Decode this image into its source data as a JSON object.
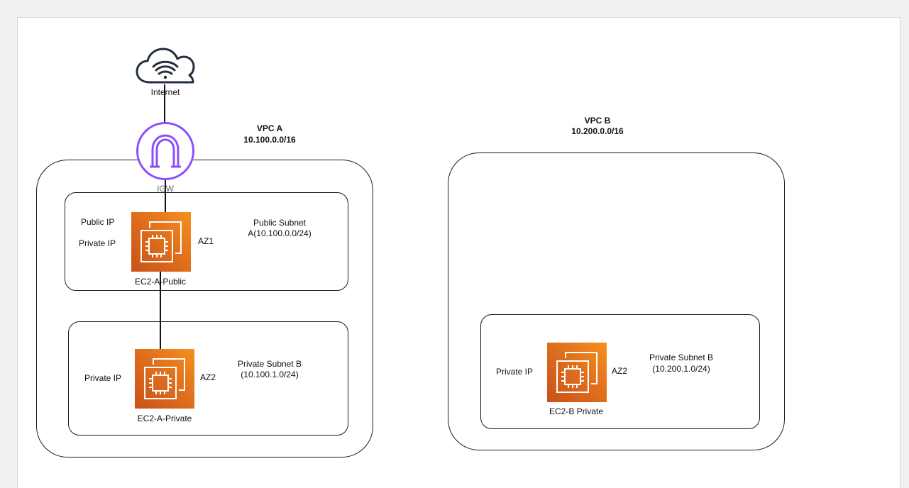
{
  "internet": {
    "label": "Internet"
  },
  "igw": {
    "label": "IGW",
    "color": "#8c4fff"
  },
  "vpc_a": {
    "title": "VPC A",
    "cidr": "10.100.0.0/16",
    "public_subnet": {
      "title_line1": "Public Subnet",
      "title_line2": "A(10.100.0.0/24)",
      "public_ip": "Public IP",
      "private_ip": "Private IP",
      "az": "AZ1",
      "instance": "EC2-A-Public"
    },
    "private_subnet": {
      "title_line1": "Private Subnet B",
      "title_line2": "(10.100.1.0/24)",
      "private_ip": "Private IP",
      "az": "AZ2",
      "instance": "EC2-A-Private"
    }
  },
  "vpc_b": {
    "title": "VPC B",
    "cidr": "10.200.0.0/16",
    "private_subnet": {
      "title_line1": "Private Subnet B",
      "title_line2": "(10.200.1.0/24)",
      "private_ip": "Private IP",
      "az": "AZ2",
      "instance": "EC2-B Private"
    }
  },
  "colors": {
    "ec2_orange": "#e0701c",
    "line": "#111111"
  }
}
